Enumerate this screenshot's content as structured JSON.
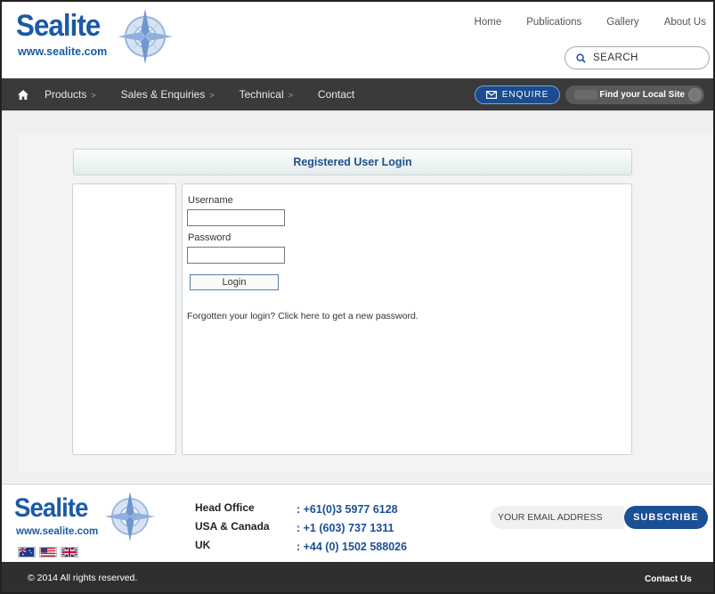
{
  "brand": {
    "name": "Sealite",
    "url": "www.sealite.com",
    "primary_color": "#1b5aa6"
  },
  "topnav": {
    "items": [
      {
        "label": "Home"
      },
      {
        "label": "Publications"
      },
      {
        "label": "Gallery"
      },
      {
        "label": "About Us"
      }
    ]
  },
  "search": {
    "label": "SEARCH",
    "icon": "search-icon"
  },
  "mainnav": {
    "home_icon": "home-icon",
    "items": [
      {
        "label": "Products",
        "arrow": ">"
      },
      {
        "label": "Sales & Enquiries",
        "arrow": ">"
      },
      {
        "label": "Technical",
        "arrow": ">"
      },
      {
        "label": "Contact",
        "arrow": ""
      }
    ],
    "enquire_label": "ENQUIRE",
    "local_site_label": "Find your Local Site"
  },
  "login": {
    "title": "Registered User Login",
    "username_label": "Username",
    "username_value": "",
    "password_label": "Password",
    "password_value": "",
    "button_label": "Login",
    "forgot_text": "Forgotten your login? Click here to get a new password."
  },
  "footer": {
    "offices": [
      {
        "name": "Head Office",
        "phone": ": +61(0)3 5977 6128"
      },
      {
        "name": "USA & Canada",
        "phone": ": +1 (603) 737 1311"
      },
      {
        "name": "UK",
        "phone": ": +44 (0) 1502 588026"
      }
    ],
    "email_placeholder": "YOUR EMAIL ADDRESS",
    "subscribe_label": "SUBSCRIBE",
    "flags": [
      "australia-flag-icon",
      "usa-flag-icon",
      "uk-flag-icon"
    ],
    "copyright": "© 2014 All rights reserved.",
    "contact_label": "Contact Us"
  },
  "colors": {
    "nav_bg": "#3a3a3a",
    "accent_blue": "#1b4f96",
    "content_bg": "#efefef"
  }
}
